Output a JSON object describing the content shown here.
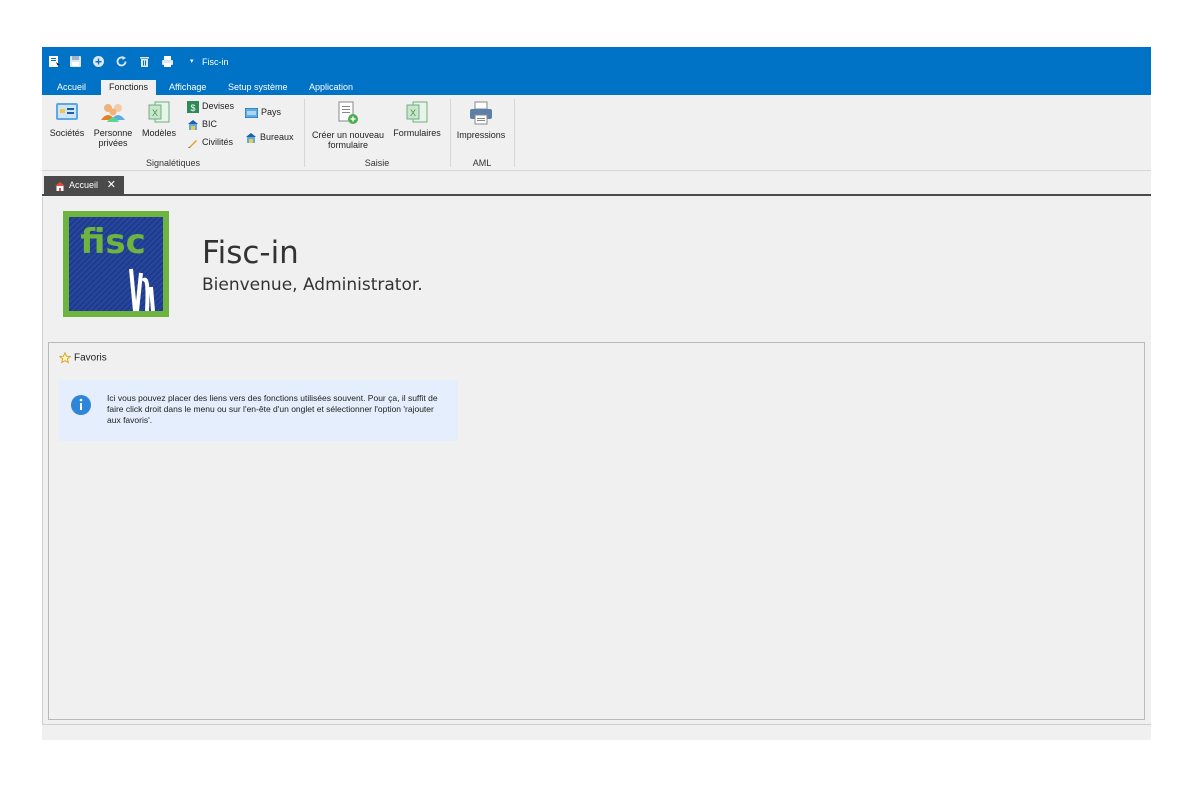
{
  "app": {
    "title": "Fisc-in"
  },
  "quick_access": {
    "icons": [
      "open-icon",
      "save-icon",
      "add-icon",
      "refresh-icon",
      "delete-icon",
      "print-icon"
    ],
    "dropdown": "▾"
  },
  "ribbon": {
    "tabs": [
      {
        "label": "Accueil",
        "active": false
      },
      {
        "label": "Fonctions",
        "active": true
      },
      {
        "label": "Affichage",
        "active": false
      },
      {
        "label": "Setup système",
        "active": false
      },
      {
        "label": "Application",
        "active": false
      }
    ],
    "groups": [
      {
        "label": "Signalétiques"
      },
      {
        "label": "Saisie"
      },
      {
        "label": "AML"
      }
    ],
    "buttons": {
      "societes": "Sociétés",
      "personnes_line1": "Personne",
      "personnes_line2": "privées",
      "modeles": "Modèles",
      "devises": "Devises",
      "bic": "BIC",
      "civilites": "Civilités",
      "pays": "Pays",
      "bureaux": "Bureaux",
      "creer_line1": "Créer un nouveau",
      "creer_line2": "formulaire",
      "formulaires": "Formulaires",
      "impressions": "Impressions"
    }
  },
  "doc_tabs": [
    {
      "label": "Accueil",
      "close": "✕"
    }
  ],
  "welcome": {
    "logo_text": "fisc",
    "title": "Fisc-in",
    "subtitle": "Bienvenue, Administrator."
  },
  "favorites": {
    "title": "Favoris",
    "info_text": "Ici vous pouvez placer des liens vers des fonctions utilisées souvent.  Pour ça, il suffit de faire click droit dans le menu ou sur l'en-ête d'un onglet et sélectionner l'option 'rajouter aux favoris'."
  },
  "colors": {
    "titlebar": "#0173c7",
    "doc_tab": "#4a4a4a",
    "info_box": "#e4eefc",
    "logo_green": "#6fb43f",
    "logo_blue": "#1e3a8c"
  }
}
